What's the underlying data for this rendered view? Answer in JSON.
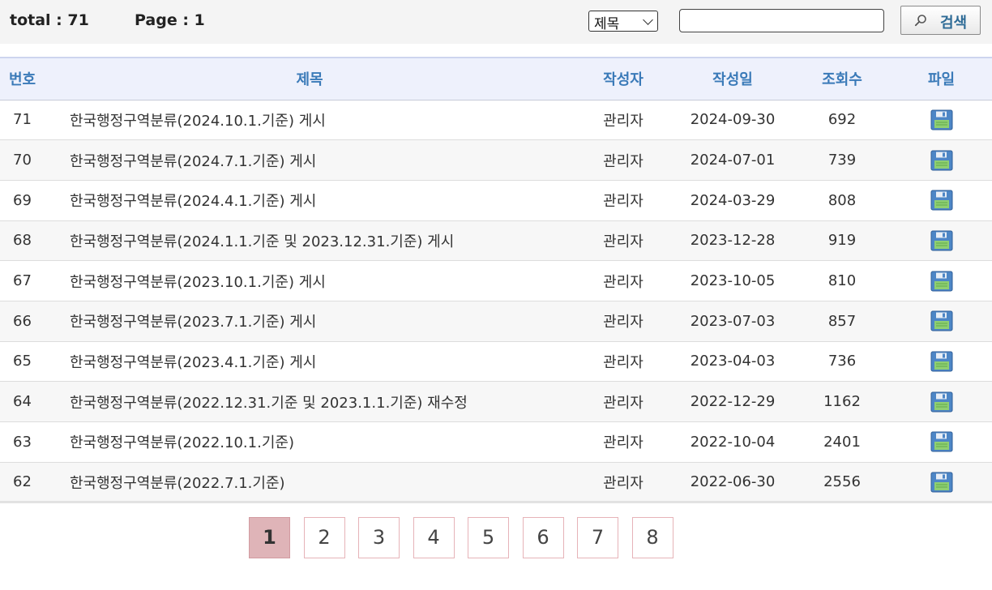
{
  "header": {
    "total_text": "total : 71",
    "page_text": "Page : 1"
  },
  "search": {
    "field_selected": "제목",
    "input_value": "",
    "button_label": "검색",
    "button_icon": "search-icon"
  },
  "table": {
    "columns": [
      "번호",
      "제목",
      "작성자",
      "작성일",
      "조회수",
      "파일"
    ],
    "rows": [
      {
        "num": "71",
        "title": "한국행정구역분류(2024.10.1.기준) 게시",
        "author": "관리자",
        "date": "2024-09-30",
        "views": "692",
        "file_icon": "floppy-disk-icon"
      },
      {
        "num": "70",
        "title": "한국행정구역분류(2024.7.1.기준) 게시",
        "author": "관리자",
        "date": "2024-07-01",
        "views": "739",
        "file_icon": "floppy-disk-icon"
      },
      {
        "num": "69",
        "title": "한국행정구역분류(2024.4.1.기준) 게시",
        "author": "관리자",
        "date": "2024-03-29",
        "views": "808",
        "file_icon": "floppy-disk-icon"
      },
      {
        "num": "68",
        "title": "한국행정구역분류(2024.1.1.기준 및 2023.12.31.기준) 게시",
        "author": "관리자",
        "date": "2023-12-28",
        "views": "919",
        "file_icon": "floppy-disk-icon"
      },
      {
        "num": "67",
        "title": "한국행정구역분류(2023.10.1.기준) 게시",
        "author": "관리자",
        "date": "2023-10-05",
        "views": "810",
        "file_icon": "floppy-disk-icon"
      },
      {
        "num": "66",
        "title": "한국행정구역분류(2023.7.1.기준) 게시",
        "author": "관리자",
        "date": "2023-07-03",
        "views": "857",
        "file_icon": "floppy-disk-icon"
      },
      {
        "num": "65",
        "title": "한국행정구역분류(2023.4.1.기준) 게시",
        "author": "관리자",
        "date": "2023-04-03",
        "views": "736",
        "file_icon": "floppy-disk-icon"
      },
      {
        "num": "64",
        "title": "한국행정구역분류(2022.12.31.기준 및 2023.1.1.기준) 재수정",
        "author": "관리자",
        "date": "2022-12-29",
        "views": "1162",
        "file_icon": "floppy-disk-icon"
      },
      {
        "num": "63",
        "title": "한국행정구역분류(2022.10.1.기준)",
        "author": "관리자",
        "date": "2022-10-04",
        "views": "2401",
        "file_icon": "floppy-disk-icon"
      },
      {
        "num": "62",
        "title": "한국행정구역분류(2022.7.1.기준)",
        "author": "관리자",
        "date": "2022-06-30",
        "views": "2556",
        "file_icon": "floppy-disk-icon"
      }
    ]
  },
  "pagination": {
    "pages": [
      "1",
      "2",
      "3",
      "4",
      "5",
      "6",
      "7",
      "8"
    ],
    "current": "1"
  },
  "colors": {
    "header_text": "#3a7ab8",
    "header_bg": "#eef1fc",
    "active_page_bg": "#dfb4b8",
    "page_border": "#e6b3b8",
    "search_label": "#2e6b96"
  }
}
